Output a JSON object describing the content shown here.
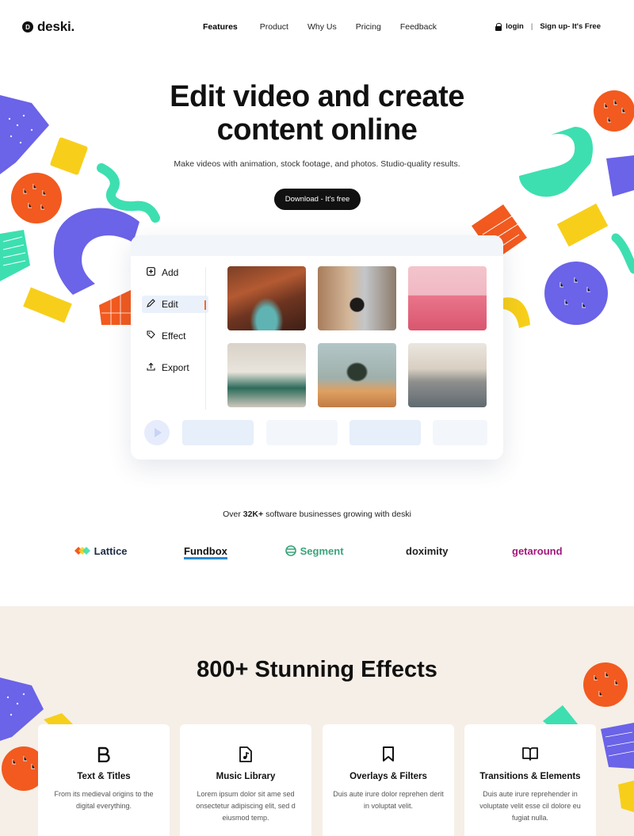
{
  "nav": {
    "logo_mark": "D",
    "logo_text": "deski.",
    "menu": [
      "Features",
      "Product",
      "Why Us",
      "Pricing",
      "Feedback"
    ],
    "login": "login",
    "separator": "|",
    "signup": "Sign up- It's Free"
  },
  "hero": {
    "title_line1": "Edit video and create",
    "title_line2": "content online",
    "subtitle": "Make videos with animation, stock footage, and photos. Studio-quality results.",
    "cta": "Download - It's free"
  },
  "editor": {
    "sidebar": [
      {
        "label": "Add",
        "icon": "plus-square-icon"
      },
      {
        "label": "Edit",
        "icon": "pencil-icon"
      },
      {
        "label": "Effect",
        "icon": "tag-icon"
      },
      {
        "label": "Export",
        "icon": "upload-icon"
      }
    ],
    "active_item": "Edit",
    "thumbnails": [
      "canyon",
      "woman-on-steps",
      "pink-building",
      "living-room",
      "person-crouching",
      "woman-on-cliff"
    ]
  },
  "trust": {
    "prefix": "Over ",
    "count": "32K+",
    "suffix": " software businesses growing with deski"
  },
  "logos": [
    "Lattice",
    "Fundbox",
    "Segment",
    "doximity",
    "getaround"
  ],
  "effects": {
    "title": "800+ Stunning Effects",
    "cards": [
      {
        "icon": "bold-icon",
        "title": "Text & Titles",
        "text": "From its medieval origins to the digital everything."
      },
      {
        "icon": "music-file-icon",
        "title": "Music Library",
        "text": "Lorem ipsum dolor sit ame sed onsectetur adipiscing elit, sed d eiusmod temp."
      },
      {
        "icon": "bookmark-icon",
        "title": "Overlays & Filters",
        "text": "Duis aute irure dolor reprehen derit in voluptat velit."
      },
      {
        "icon": "book-open-icon",
        "title": "Transitions & Elements",
        "text": "Duis aute irure reprehender in voluptate velit esse cil dolore eu fugiat nulla."
      }
    ]
  },
  "colors": {
    "accent_dark": "#111111",
    "orange": "#f25a1f",
    "purple": "#6b63e8",
    "teal": "#3ddfb0",
    "yellow": "#f7cf1a",
    "beige": "#f5efe7"
  }
}
